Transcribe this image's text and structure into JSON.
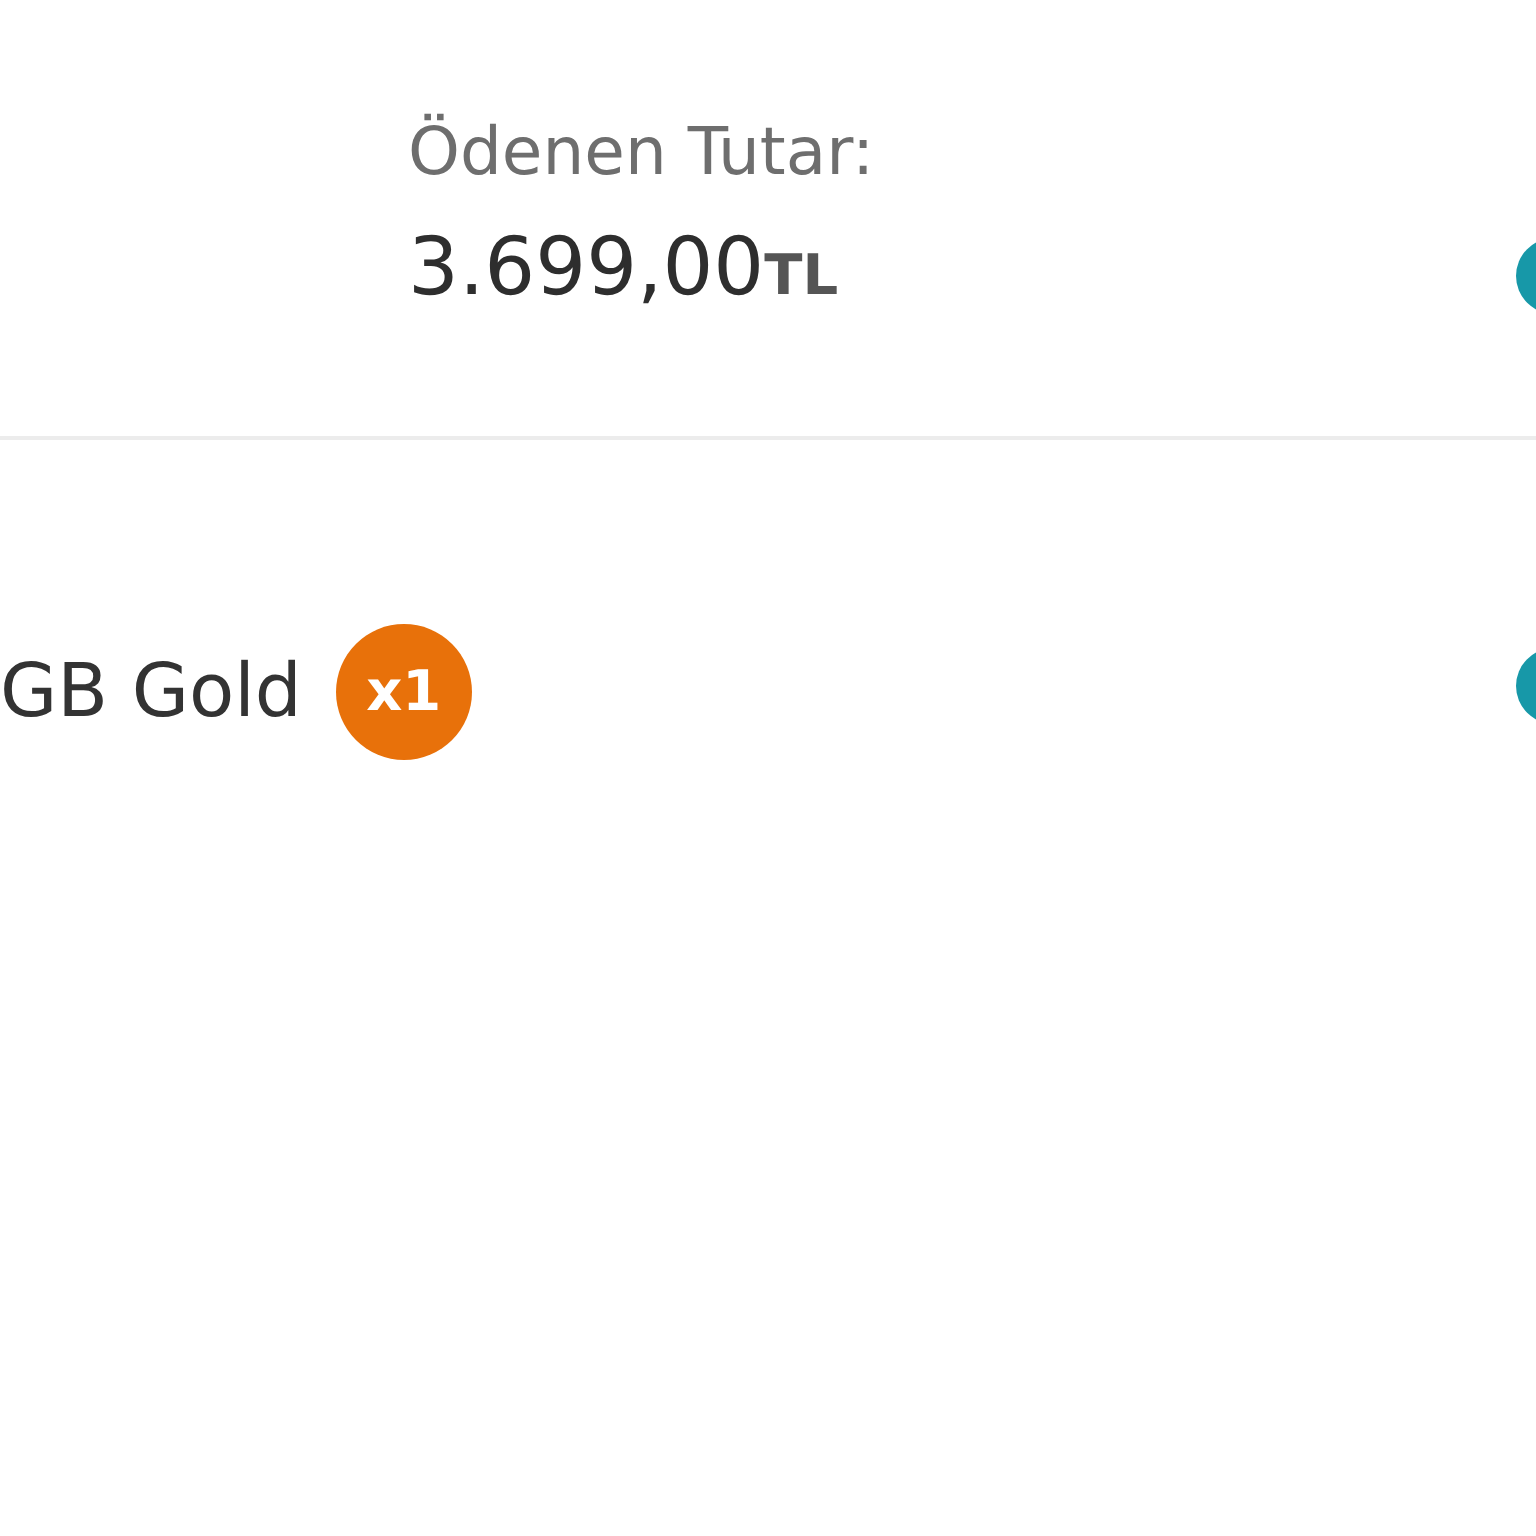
{
  "payment_summary": {
    "paid_label": "Ödenen Tutar:",
    "paid_amount": "3.699,00",
    "paid_currency": "TL"
  },
  "order_item": {
    "name": "GB Gold",
    "quantity_badge": "x1"
  }
}
